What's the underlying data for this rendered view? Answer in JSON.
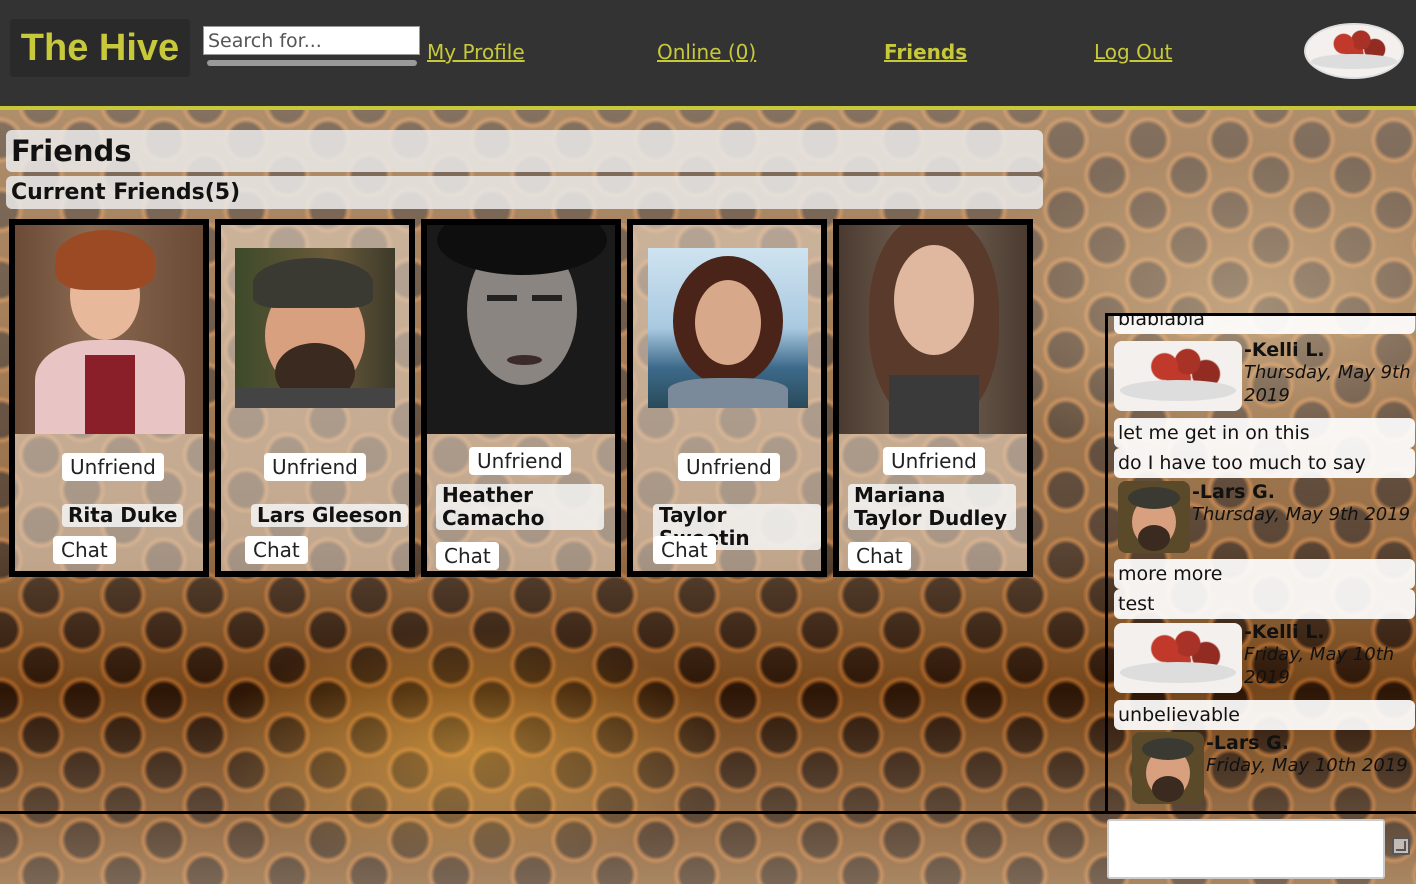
{
  "header": {
    "logo": "The Hive",
    "search_placeholder": "Search for...",
    "nav": {
      "profile": "My Profile",
      "online": "Online (0)",
      "friends": "Friends",
      "logout": "Log Out"
    },
    "accent_color": "#c7c83a"
  },
  "main": {
    "title": "Friends",
    "subtitle": "Current Friends(5)",
    "friends": [
      {
        "name": "Rita Duke",
        "unfriend": "Unfriend",
        "chat": "Chat"
      },
      {
        "name": "Lars Gleeson",
        "unfriend": "Unfriend",
        "chat": "Chat"
      },
      {
        "name": "Heather Camacho",
        "unfriend": "Unfriend",
        "chat": "Chat"
      },
      {
        "name": "Taylor Sweetin",
        "unfriend": "Unfriend",
        "chat": "Chat"
      },
      {
        "name": "Mariana Taylor Dudley",
        "unfriend": "Unfriend",
        "chat": "Chat"
      }
    ]
  },
  "chat": {
    "messages": [
      {
        "type": "text",
        "text": "blablabla"
      },
      {
        "type": "sender",
        "who": "-Kelli L.",
        "when": "Thursday, May 9th 2019"
      },
      {
        "type": "text",
        "text": "let me get in on this"
      },
      {
        "type": "text",
        "text": "do I have too much to say"
      },
      {
        "type": "sender",
        "who": "-Lars G.",
        "when": "Thursday, May 9th 2019"
      },
      {
        "type": "text",
        "text": "more more"
      },
      {
        "type": "text",
        "text": "test"
      },
      {
        "type": "sender",
        "who": "-Kelli L.",
        "when": "Friday, May 10th 2019"
      },
      {
        "type": "text",
        "text": "unbelievable"
      },
      {
        "type": "sender",
        "who": "-Lars G.",
        "when": "Friday, May 10th 2019"
      }
    ]
  }
}
